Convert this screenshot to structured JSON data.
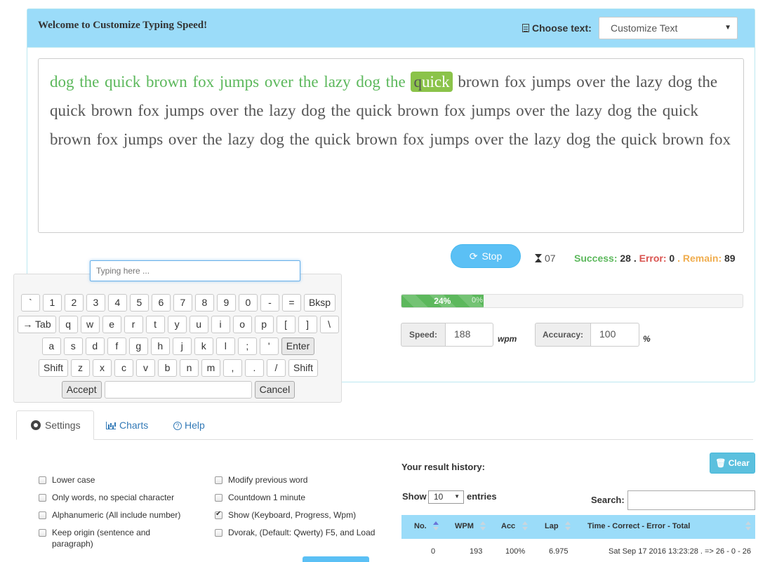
{
  "header": {
    "welcome": "Welcome to Customize Typing Speed!",
    "choose_label": "Choose text:",
    "text_select_value": "Customize Text"
  },
  "typing": {
    "done_text": "dog the quick brown fox jumps over the lazy dog the ",
    "current_typed": "q",
    "current_cursor": "u",
    "current_rest": "ick",
    "remaining_text": " brown fox jumps over the lazy dog the quick brown fox jumps over the lazy dog the quick brown fox jumps over the lazy dog the quick brown fox jumps over the lazy dog the quick brown fox jumps over the lazy dog the quick brown fox",
    "input_placeholder": "Typing here ..."
  },
  "controls": {
    "stop_label": "Stop",
    "timer": "07",
    "success_label": "Success:",
    "success_value": "28",
    "error_label": "Error:",
    "error_value": "0",
    "remain_label": "Remain:",
    "remain_value": "89",
    "sep": "."
  },
  "progress": {
    "percent": 24,
    "label": "24%",
    "rest_label": "0%"
  },
  "metrics": {
    "speed_label": "Speed:",
    "speed_value": "188",
    "speed_unit": "wpm",
    "accuracy_label": "Accuracy:",
    "accuracy_value": "100",
    "accuracy_unit": "%"
  },
  "keyboard": {
    "rows": [
      [
        "`",
        "1",
        "2",
        "3",
        "4",
        "5",
        "6",
        "7",
        "8",
        "9",
        "0",
        "-",
        "=",
        "Bksp"
      ],
      [
        "→ Tab",
        "q",
        "w",
        "e",
        "r",
        "t",
        "y",
        "u",
        "i",
        "o",
        "p",
        "[",
        "]",
        "\\"
      ],
      [
        "a",
        "s",
        "d",
        "f",
        "g",
        "h",
        "j",
        "k",
        "l",
        ";",
        "'",
        "Enter"
      ],
      [
        "Shift",
        "z",
        "x",
        "c",
        "v",
        "b",
        "n",
        "m",
        ",",
        ".",
        "/",
        "Shift"
      ]
    ],
    "accept": "Accept",
    "cancel": "Cancel"
  },
  "tabs": {
    "settings": "Settings",
    "charts": "Charts",
    "help": "Help"
  },
  "settings": {
    "left": [
      {
        "label": "Lower case",
        "checked": false
      },
      {
        "label": "Only words, no special character",
        "checked": false
      },
      {
        "label": "Alphanumeric (All include number)",
        "checked": false
      },
      {
        "label": "Keep origin (sentence and paragraph)",
        "checked": false
      }
    ],
    "right": [
      {
        "label": "Modify previous word",
        "checked": false
      },
      {
        "label": "Countdown 1 minute",
        "checked": false
      },
      {
        "label": "Show (Keyboard, Progress, Wpm)",
        "checked": true
      },
      {
        "label": "Dvorak, (Default: Qwerty) F5, and Load",
        "checked": false
      }
    ]
  },
  "history": {
    "title": "Your result history:",
    "clear": "Clear",
    "show": "Show",
    "entries_value": "10",
    "entries": "entries",
    "search": "Search:",
    "columns": [
      "No.",
      "WPM",
      "Acc",
      "Lap",
      "Time - Correct - Error - Total"
    ],
    "rows": [
      [
        "0",
        "193",
        "100%",
        "6.975",
        "Sat Sep 17 2016 13:23:28 . => 26 - 0 - 26"
      ]
    ]
  }
}
